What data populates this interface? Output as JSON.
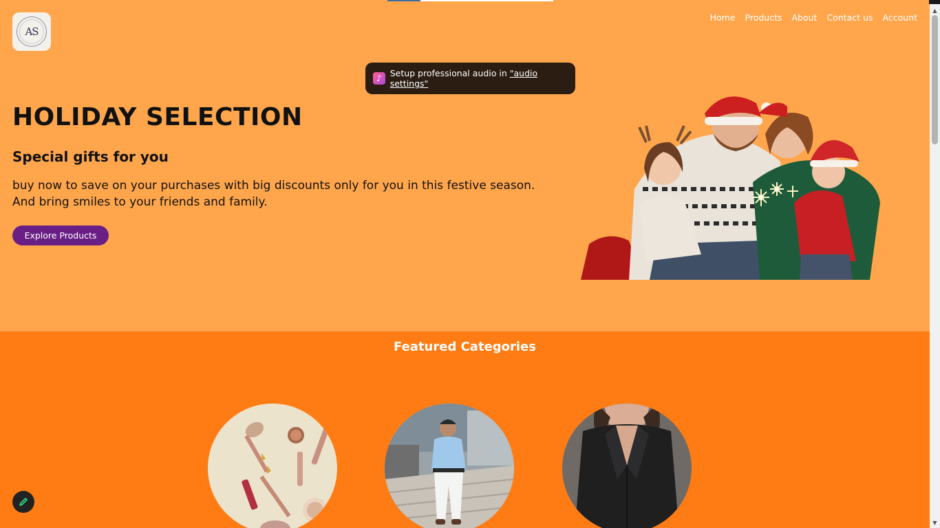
{
  "logo": {
    "text": "AS"
  },
  "nav": {
    "items": [
      "Home",
      "Products",
      "About",
      "Contact us",
      "Account"
    ]
  },
  "toast": {
    "icon": "music-note-icon",
    "text": "Setup professional audio in ",
    "link": "\"audio settings\""
  },
  "hero": {
    "title": "HOLIDAY SELECTION",
    "subtitle": "Special gifts for you",
    "description_line1": "buy now to save on your purchases with big discounts only for you in this festive season.",
    "description_line2": "And bring smiles to your friends and family.",
    "button_label": "Explore Products"
  },
  "featured": {
    "title": "Featured Categories",
    "categories": [
      {
        "icon": "cosmetics-image"
      },
      {
        "icon": "men-fashion-image"
      },
      {
        "icon": "women-fashion-image"
      }
    ]
  },
  "colors": {
    "hero_bg": "#ffa64d",
    "featured_bg": "#ff7c14",
    "button_bg": "#6a1f86",
    "toast_bg": "#2b1d12"
  },
  "edit_button": {
    "icon": "pencil-icon"
  }
}
